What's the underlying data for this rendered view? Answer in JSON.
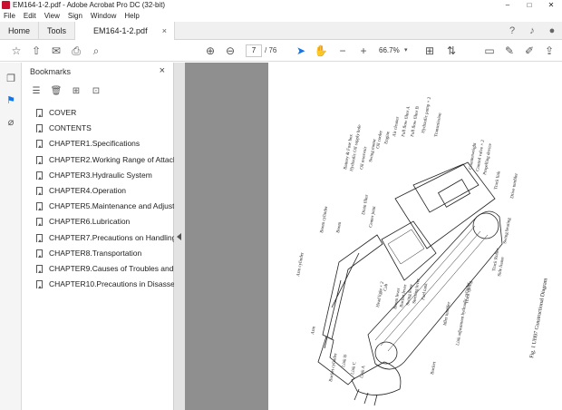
{
  "window": {
    "title": "EM164-1-2.pdf - Adobe Acrobat Pro DC (32-bit)",
    "controls": [
      "–",
      "□",
      "✕"
    ]
  },
  "menu": [
    "File",
    "Edit",
    "View",
    "Sign",
    "Window",
    "Help"
  ],
  "tabs": {
    "home": "Home",
    "tools": "Tools",
    "document": "EM164-1-2.pdf",
    "close": "×"
  },
  "toolbar": {
    "current_page": "7",
    "total_pages": "/ 76",
    "zoom": "66.7%"
  },
  "bookmarks_panel": {
    "title": "Bookmarks",
    "close": "×",
    "items": [
      "COVER",
      "CONTENTS",
      "CHAPTER1.Specifications",
      "CHAPTER2.Working Range of Attachm",
      "CHAPTER3.Hydraulic System",
      "CHAPTER4.Operation",
      "CHAPTER5.Maintenance and Adjustme",
      "CHAPTER6.Lubrication",
      "CHAPTER7.Precautions on Handling At",
      "CHAPTER8.Transportation",
      "CHAPTER9.Causes of Troubles and The",
      "CHAPTER10.Precautions in Disassembl"
    ]
  },
  "icons": {
    "titlebar": "acrobat-icon",
    "toolbar": [
      "star-icon",
      "upload-icon",
      "print-icon",
      "search-icon",
      "page-up-icon",
      "page-down-icon",
      "select-arrow-icon",
      "hand-icon",
      "zoom-out-icon",
      "zoom-in-icon",
      "fit-page-icon",
      "comment-icon",
      "pen-icon",
      "highlight-icon",
      "share-icon"
    ]
  },
  "diagram": {
    "caption": "Fig. 1   UH07 Constructional Diagram",
    "labels": {
      "l1": "Battery & Fuse box",
      "l2": "Hydraulic Oil supply hole",
      "l3": "Oil reservoir",
      "l4": "Swing motor",
      "l5": "Oil cooler",
      "l6": "Engine",
      "l7": "Air cleaner",
      "l8": "Full flow filter A",
      "l9": "Full flow filter B",
      "l10": "Hydraulic pump × 2",
      "l11": "Transmission",
      "l12": "Counterweight",
      "l13": "Control valve × 2",
      "l14": "Propelling device",
      "l15": "Track link",
      "l16": "Drive tumbler",
      "l17": "Swing bearing",
      "l18": "Track Roller",
      "l19": "Side frame",
      "l20": "Track spring",
      "l21": "Link adjustment hydraulic cylinder",
      "l22": "Idler tumbler",
      "l23": "Fuel tank",
      "l24": "Steering lever",
      "l25": "Swing lever",
      "l26": "Bucket lever",
      "l27": "Boom lever",
      "l28": "Cab",
      "l29": "Head light × 2",
      "l30": "Drain filter",
      "l31": "Center joint",
      "l32": "Boom cylinder",
      "l33": "Boom",
      "l34": "Arm cylinder",
      "l35": "Arm",
      "l36": "Bucket cylinder",
      "l37": "Link B",
      "l38": "Link C",
      "l39": "Link A",
      "l40": "Bucket"
    }
  }
}
